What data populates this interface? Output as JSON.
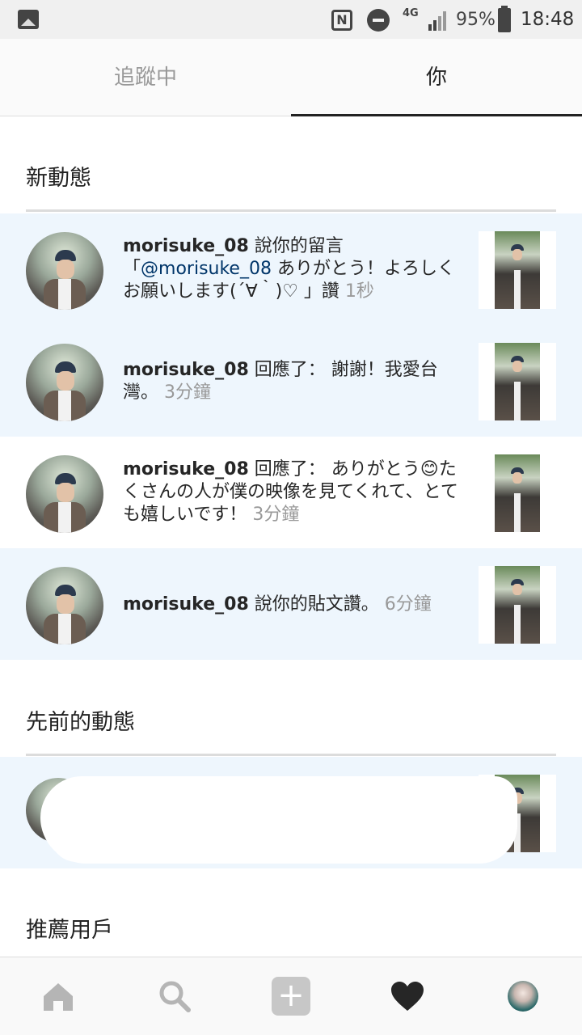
{
  "status_bar": {
    "network": "4G",
    "battery": "95%",
    "time": "18:48"
  },
  "tabs": {
    "following": "追蹤中",
    "you": "你"
  },
  "sections": {
    "new_activity": "新動態",
    "earlier_activity": "先前的動態",
    "suggested_users": "推薦用戶"
  },
  "notifications": [
    {
      "username": "morisuke_08",
      "action": " 說你的留言",
      "body_prefix": "「",
      "mention": "@morisuke_08",
      "body": " ありがとう！よろしくお願いします(´∀｀)♡ 」讚",
      "time": " 1秒"
    },
    {
      "username": "morisuke_08",
      "action": " 回應了：",
      "body": " 謝謝！我愛台灣。",
      "time": " 3分鐘"
    },
    {
      "username": "morisuke_08",
      "action": " 回應了：",
      "body": " ありがとう😊たくさんの人が僕の映像を見てくれて、とても嬉しいです！",
      "time": " 3分鐘"
    },
    {
      "username": "morisuke_08",
      "action": " 說你的貼文讚。",
      "time": " 6分鐘"
    }
  ],
  "bottom_nav": {
    "add_symbol": "+"
  }
}
